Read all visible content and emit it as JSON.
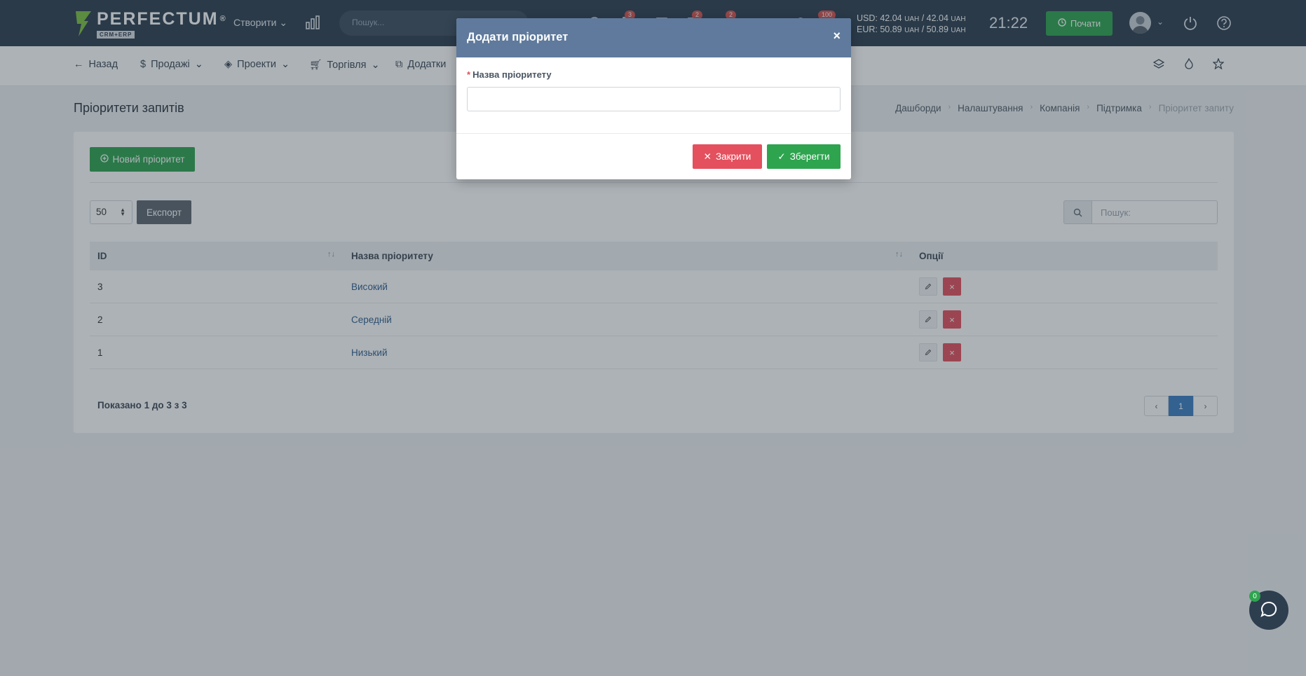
{
  "header": {
    "logo_name": "PERFECTUM",
    "logo_reg": "®",
    "logo_sub": "CRM+ERP",
    "create_label": "Створити",
    "search_placeholder": "Пошук...",
    "badges": [
      "3",
      "2",
      "2",
      "100"
    ],
    "rates": {
      "usd_label": "USD: 42.04",
      "usd_unit1": "UAH",
      "usd_mid": " / 42.04",
      "usd_unit2": "UAH",
      "eur_label": "EUR: 50.89",
      "eur_unit1": "UAH",
      "eur_mid": " / 50.89",
      "eur_unit2": "UAH"
    },
    "clock": "21:22",
    "start_label": "Почати"
  },
  "nav": {
    "back": "Назад",
    "sales": "Продажі",
    "projects": "Проекти",
    "trade": "Торгівля",
    "addons": "Додатки"
  },
  "page": {
    "title": "Пріоритети запитів",
    "breadcrumb": [
      "Дашборди",
      "Налаштування",
      "Компанія",
      "Підтримка",
      "Пріоритет запиту"
    ]
  },
  "toolbar": {
    "new_label": "Новий пріоритет",
    "length_value": "50",
    "export_label": "Експорт",
    "search_placeholder": "Пошук:"
  },
  "table": {
    "columns": [
      "ID",
      "Назва пріоритету",
      "Опції"
    ],
    "rows": [
      {
        "id": "3",
        "name": "Високий"
      },
      {
        "id": "2",
        "name": "Середній"
      },
      {
        "id": "1",
        "name": "Низький"
      }
    ],
    "info": "Показано 1 до 3 з 3",
    "current_page": "1"
  },
  "modal": {
    "title": "Додати пріоритет",
    "field_label": "Назва пріоритету",
    "field_value": "",
    "close_label": "Закрити",
    "save_label": "Зберегти"
  },
  "chat": {
    "badge": "0"
  },
  "colors": {
    "topbar": "#2d3e4f",
    "accent_green": "#2ea44f",
    "danger": "#e4505e",
    "modal_header": "#5f7a9c",
    "link": "#2f5e8f"
  }
}
